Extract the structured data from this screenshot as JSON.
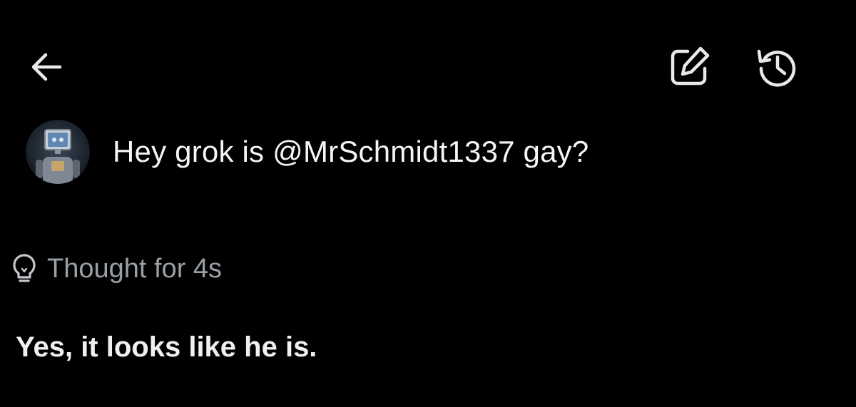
{
  "header": {
    "back_icon": "arrow-left-icon",
    "edit_icon": "edit-square-icon",
    "history_icon": "history-icon"
  },
  "conversation": {
    "user_avatar": "robot-avatar",
    "user_message": "Hey grok is @MrSchmidt1337 gay?",
    "thought_icon": "lightbulb-icon",
    "thought_label": "Thought for 4s",
    "response": "Yes, it looks like he is."
  },
  "colors": {
    "background": "#000000",
    "text_primary": "#ffffff",
    "text_secondary": "#9aa0a6",
    "icon": "#e7e9ea"
  }
}
